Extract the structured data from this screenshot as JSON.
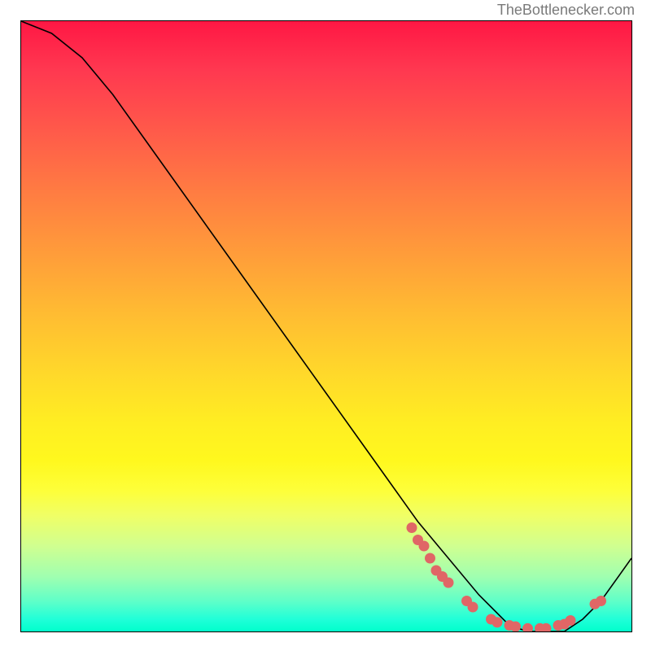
{
  "attribution": "TheBottlenecker.com",
  "chart_data": {
    "type": "line",
    "title": "",
    "xlabel": "",
    "ylabel": "",
    "xlim": [
      0,
      100
    ],
    "ylim": [
      0,
      100
    ],
    "series": [
      {
        "name": "curve",
        "x": [
          0,
          5,
          10,
          15,
          20,
          25,
          30,
          35,
          40,
          45,
          50,
          55,
          60,
          65,
          70,
          75,
          78,
          80,
          83,
          86,
          89,
          92,
          95,
          100
        ],
        "y": [
          100,
          98,
          94,
          88,
          81,
          74,
          67,
          60,
          53,
          46,
          39,
          32,
          25,
          18,
          12,
          6,
          3,
          1,
          0,
          0,
          0,
          2,
          5,
          12
        ]
      }
    ],
    "markers": {
      "name": "highlighted-points",
      "color": "#e06666",
      "points": [
        {
          "x": 64,
          "y": 17
        },
        {
          "x": 65,
          "y": 15
        },
        {
          "x": 66,
          "y": 14
        },
        {
          "x": 67,
          "y": 12
        },
        {
          "x": 68,
          "y": 10
        },
        {
          "x": 69,
          "y": 9
        },
        {
          "x": 70,
          "y": 8
        },
        {
          "x": 73,
          "y": 5
        },
        {
          "x": 74,
          "y": 4
        },
        {
          "x": 77,
          "y": 2
        },
        {
          "x": 78,
          "y": 1.5
        },
        {
          "x": 80,
          "y": 1
        },
        {
          "x": 81,
          "y": 0.8
        },
        {
          "x": 83,
          "y": 0.5
        },
        {
          "x": 85,
          "y": 0.5
        },
        {
          "x": 86,
          "y": 0.5
        },
        {
          "x": 88,
          "y": 1
        },
        {
          "x": 89,
          "y": 1.2
        },
        {
          "x": 90,
          "y": 1.8
        },
        {
          "x": 94,
          "y": 4.5
        },
        {
          "x": 95,
          "y": 5
        }
      ]
    }
  }
}
